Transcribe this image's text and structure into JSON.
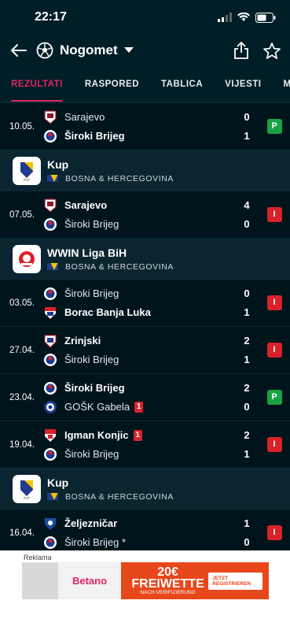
{
  "status_bar": {
    "time": "22:17"
  },
  "header": {
    "title": "Nogomet"
  },
  "tabs": [
    {
      "label": "REZULTATI",
      "active": true
    },
    {
      "label": "RASPORED",
      "active": false
    },
    {
      "label": "TABLICA",
      "active": false
    },
    {
      "label": "VIJESTI",
      "active": false
    },
    {
      "label": "MOMČ",
      "active": false
    }
  ],
  "sections": [
    {
      "type": "match",
      "date": "10.05.",
      "home": {
        "name": "Sarajevo",
        "bold": false,
        "logo": "sarajevo"
      },
      "away": {
        "name": "Široki Brijeg",
        "bold": true,
        "logo": "siroki"
      },
      "home_score": "0",
      "away_score": "1",
      "result": "P"
    },
    {
      "type": "competition",
      "name": "Kup",
      "country": "BOSNA & HERCEGOVINA",
      "logo": "kup"
    },
    {
      "type": "match",
      "date": "07.05.",
      "home": {
        "name": "Sarajevo",
        "bold": true,
        "logo": "sarajevo"
      },
      "away": {
        "name": "Široki Brijeg",
        "bold": false,
        "logo": "siroki"
      },
      "home_score": "4",
      "away_score": "0",
      "result": "I"
    },
    {
      "type": "competition",
      "name": "WWIN Liga BiH",
      "country": "BOSNA & HERCEGOVINA",
      "logo": "wwin"
    },
    {
      "type": "match",
      "date": "03.05.",
      "home": {
        "name": "Široki Brijeg",
        "bold": false,
        "logo": "siroki"
      },
      "away": {
        "name": "Borac Banja Luka",
        "bold": true,
        "logo": "borac"
      },
      "home_score": "0",
      "away_score": "1",
      "result": "I"
    },
    {
      "type": "match",
      "date": "27.04.",
      "home": {
        "name": "Zrinjski",
        "bold": true,
        "logo": "zrinjski"
      },
      "away": {
        "name": "Široki Brijeg",
        "bold": false,
        "logo": "siroki"
      },
      "home_score": "2",
      "away_score": "1",
      "result": "I"
    },
    {
      "type": "match",
      "date": "23.04.",
      "home": {
        "name": "Široki Brijeg",
        "bold": true,
        "logo": "siroki"
      },
      "away": {
        "name": "GOŠK Gabela",
        "bold": false,
        "logo": "gosk",
        "red_cards": "1"
      },
      "home_score": "2",
      "away_score": "0",
      "result": "P"
    },
    {
      "type": "match",
      "date": "19.04.",
      "home": {
        "name": "Igman Konjic",
        "bold": true,
        "logo": "igman",
        "red_cards": "1"
      },
      "away": {
        "name": "Široki Brijeg",
        "bold": false,
        "logo": "siroki"
      },
      "home_score": "2",
      "away_score": "1",
      "result": "I"
    },
    {
      "type": "competition",
      "name": "Kup",
      "country": "BOSNA & HERCEGOVINA",
      "logo": "kup"
    },
    {
      "type": "match",
      "date": "16.04.",
      "home": {
        "name": "Željezničar",
        "bold": true,
        "logo": "zeljeznicar"
      },
      "away": {
        "name": "Široki Brijeg *",
        "bold": false,
        "logo": "siroki"
      },
      "home_score": "1",
      "away_score": "0",
      "result": "I"
    }
  ],
  "ad": {
    "label": "Reklama",
    "brand": "Betano",
    "headline": "20€ FREIWETTE",
    "subline": "NACH VERIFIZIERUNG",
    "cta": "JETZT REGISTRIEREN"
  },
  "colors": {
    "accent": "#e0245e",
    "win": "#18a244",
    "loss": "#d8222a",
    "background": "#001e28"
  }
}
